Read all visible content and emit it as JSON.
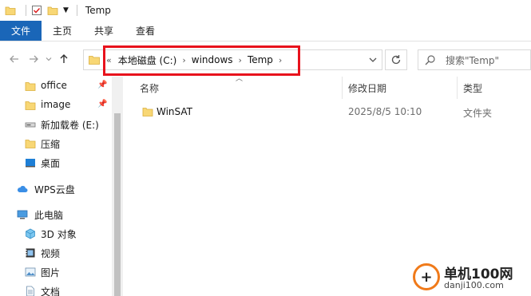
{
  "window": {
    "title": "Temp"
  },
  "ribbon": {
    "tabs": [
      "文件",
      "主页",
      "共享",
      "查看"
    ]
  },
  "address": {
    "overflow": "«",
    "crumbs": [
      "本地磁盘 (C:)",
      "windows",
      "Temp"
    ]
  },
  "search": {
    "placeholder": "搜索\"Temp\""
  },
  "nav": {
    "quick": [
      {
        "label": "office",
        "icon": "folder-icon",
        "pinned": true
      },
      {
        "label": "image",
        "icon": "folder-icon",
        "pinned": true
      },
      {
        "label": "新加载卷 (E:)",
        "icon": "drive-icon",
        "pinned": false
      },
      {
        "label": "压缩",
        "icon": "folder-icon",
        "pinned": false
      },
      {
        "label": "桌面",
        "icon": "desktop-icon",
        "pinned": false
      }
    ],
    "wps": {
      "label": "WPS云盘",
      "icon": "cloud-icon"
    },
    "pc": {
      "label": "此电脑",
      "icon": "computer-icon"
    },
    "pc_items": [
      {
        "label": "3D 对象",
        "icon": "cube-icon"
      },
      {
        "label": "视频",
        "icon": "video-icon"
      },
      {
        "label": "图片",
        "icon": "picture-icon"
      },
      {
        "label": "文档",
        "icon": "document-icon"
      }
    ]
  },
  "columns": {
    "name": "名称",
    "modified": "修改日期",
    "type": "类型"
  },
  "files": [
    {
      "name": "WinSAT",
      "modified": "2025/8/5 10:10",
      "type": "文件夹"
    }
  ],
  "watermark": {
    "title": "单机100网",
    "url": "danji100.com"
  },
  "colors": {
    "accent": "#1a66b8",
    "highlight": "#e8121c",
    "folder": "#f8d775",
    "watermark": "#f07a1a"
  }
}
